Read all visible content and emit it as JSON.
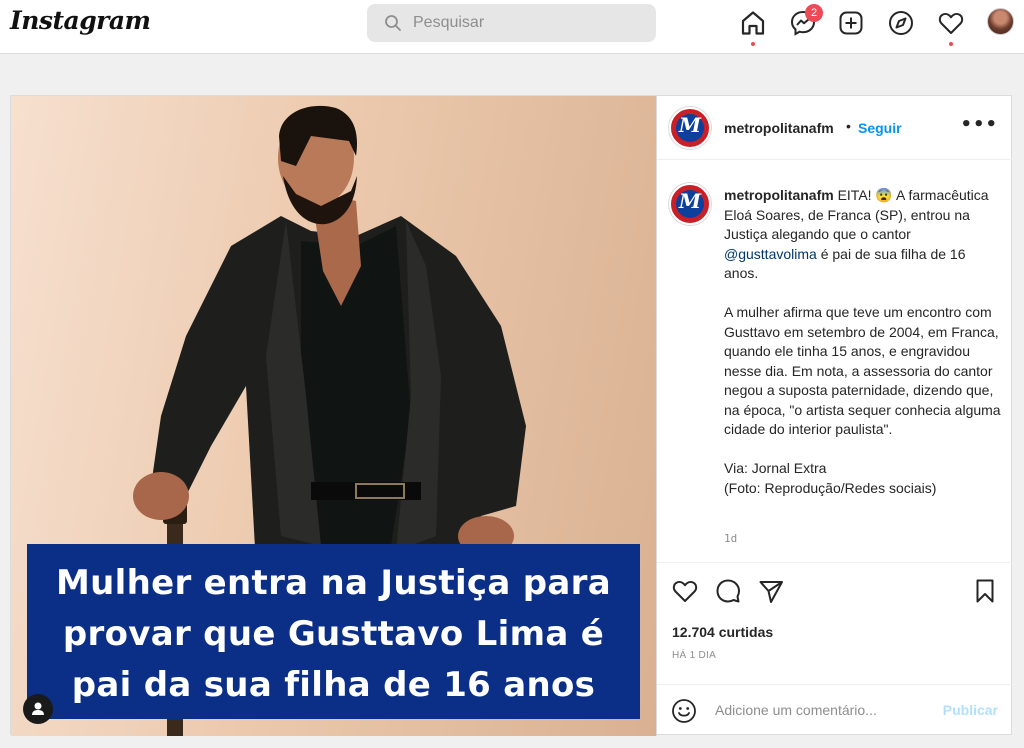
{
  "app": {
    "logo": "Instagram"
  },
  "search": {
    "placeholder": "Pesquisar"
  },
  "nav": {
    "icons": [
      "home-icon",
      "messenger-icon",
      "new-post-icon",
      "explore-icon",
      "activity-heart-icon",
      "profile-avatar"
    ],
    "messenger_badge": "2"
  },
  "colors": {
    "accent": "#0095f6",
    "badge": "#ed4956",
    "banner": "#0b2f86"
  },
  "post": {
    "image": {
      "banner_lines": [
        "Mulher entra na Justiça para",
        "provar que Gusttavo Lima é",
        "pai da sua filha de 16 anos"
      ]
    },
    "header": {
      "username": "metropolitanafm",
      "separator": "•",
      "follow_label": "Seguir",
      "more_label": "•••"
    },
    "caption": {
      "username": "metropolitanafm",
      "p1_before": " EITA! 😨 A farmacêutica Eloá Soares, de Franca (SP), entrou na Justiça alegando que o cantor ",
      "mention": "@gusttavolima",
      "p1_after": " é pai de sua filha de 16 anos.",
      "p2": "A mulher afirma que teve um encontro com Gusttavo em setembro de 2004, em Franca, quando ele tinha 15 anos, e engravidou nesse dia. Em nota, a assessoria do cantor negou a suposta paternidade, dizendo que, na época, \"o artista sequer conhecia alguma cidade do interior paulista\".",
      "p3_line1": "Via: Jornal Extra",
      "p3_line2": "(Foto: Reprodução/Redes sociais)"
    },
    "age": "1d",
    "likes": "12.704 curtidas",
    "timestamp": "HÁ 1 DIA",
    "comment": {
      "placeholder": "Adicione um comentário...",
      "publish_label": "Publicar"
    }
  }
}
